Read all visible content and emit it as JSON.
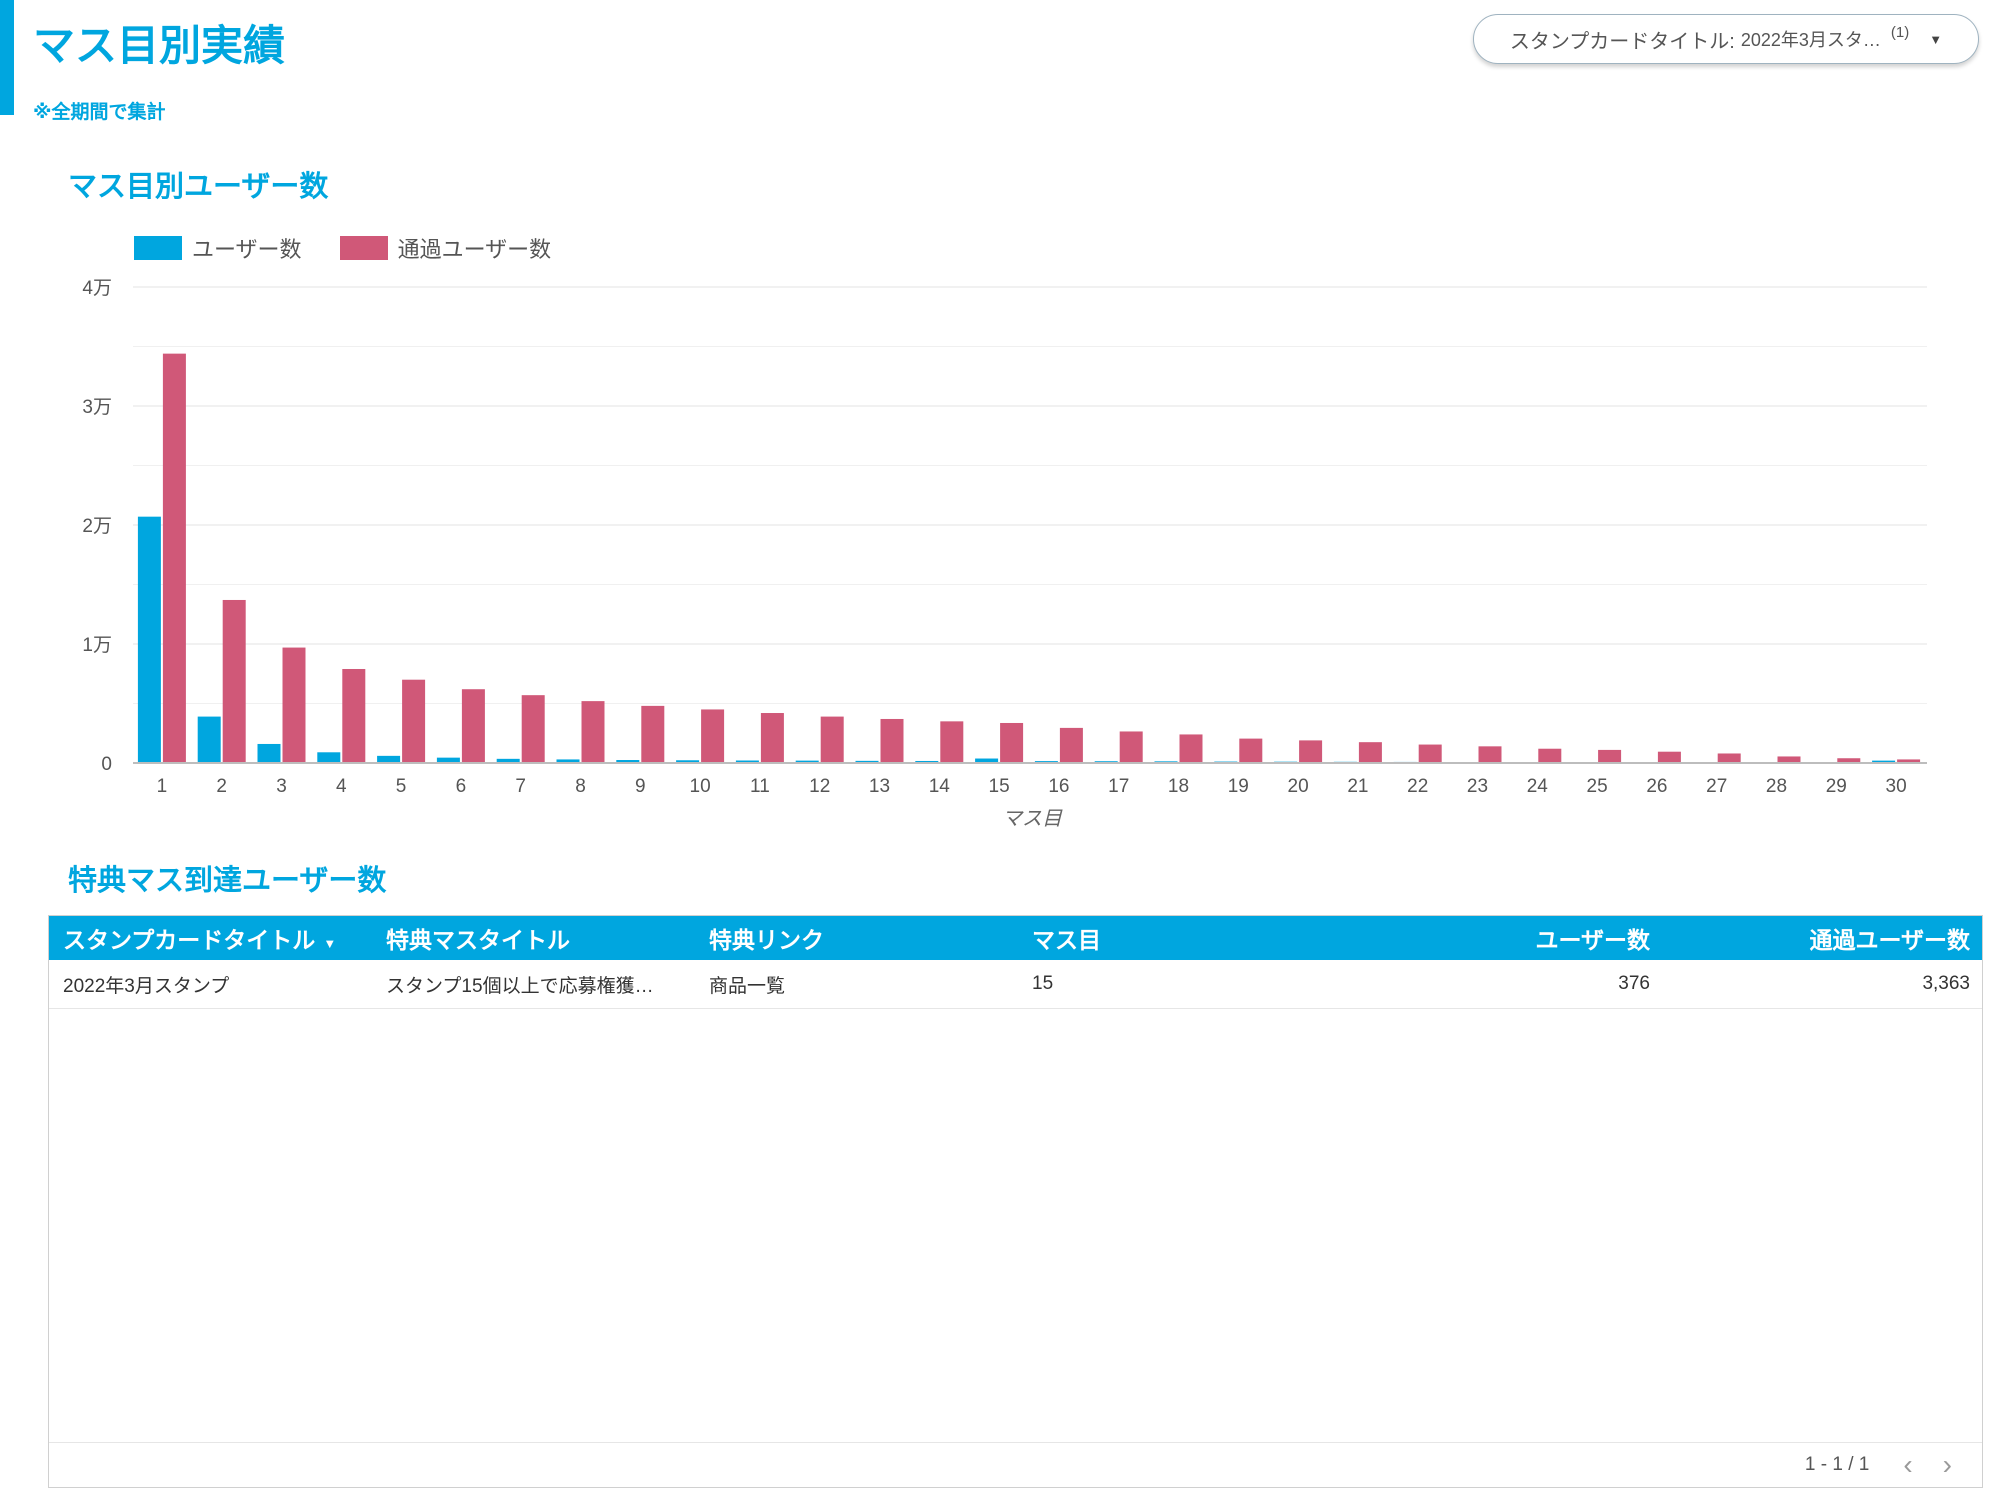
{
  "page": {
    "title": "マス目別実績",
    "note": "※全期間で集計"
  },
  "filter": {
    "label": "スタンプカードタイトル:",
    "value": "2022年3月スタ…",
    "count": "(1)"
  },
  "chart_section": {
    "title": "マス目別ユーザー数"
  },
  "chart_data": {
    "type": "bar",
    "xlabel": "マス目",
    "ylabel": "",
    "ylim": [
      0,
      40000
    ],
    "yticks": [
      0,
      10000,
      20000,
      30000,
      40000
    ],
    "ytick_labels": [
      "0",
      "1万",
      "2万",
      "3万",
      "4万"
    ],
    "grid": true,
    "legend_position": "top-left",
    "categories": [
      "1",
      "2",
      "3",
      "4",
      "5",
      "6",
      "7",
      "8",
      "9",
      "10",
      "11",
      "12",
      "13",
      "14",
      "15",
      "16",
      "17",
      "18",
      "19",
      "20",
      "21",
      "22",
      "23",
      "24",
      "25",
      "26",
      "27",
      "28",
      "29",
      "30"
    ],
    "series": [
      {
        "name": "ユーザー数",
        "color": "#00a6df",
        "values": [
          20700,
          3900,
          1600,
          900,
          600,
          450,
          350,
          300,
          250,
          230,
          210,
          200,
          180,
          170,
          376,
          160,
          150,
          140,
          120,
          110,
          100,
          90,
          80,
          70,
          60,
          50,
          40,
          30,
          30,
          200
        ]
      },
      {
        "name": "通過ユーザー数",
        "color": "#d05878",
        "values": [
          34400,
          13700,
          9700,
          7900,
          7000,
          6200,
          5700,
          5200,
          4800,
          4500,
          4200,
          3900,
          3700,
          3500,
          3363,
          2950,
          2650,
          2400,
          2050,
          1900,
          1750,
          1550,
          1400,
          1200,
          1100,
          950,
          800,
          550,
          400,
          300
        ]
      }
    ]
  },
  "table_section": {
    "title": "特典マス到達ユーザー数"
  },
  "table": {
    "columns": [
      "スタンプカードタイトル",
      "特典マスタイトル",
      "特典リンク",
      "マス目",
      "ユーザー数",
      "通過ユーザー数"
    ],
    "rows": [
      [
        "2022年3月スタンプ",
        "スタンプ15個以上で応募権獲…",
        "商品一覧",
        "15",
        "376",
        "3,363"
      ]
    ],
    "pagination": "1 - 1 / 1"
  },
  "icons": {
    "filter_caret": "caret-down-icon",
    "sort": "sort-desc-icon",
    "prev": "chevron-left-icon",
    "next": "chevron-right-icon"
  },
  "colors": {
    "accent": "#00a6df",
    "series_users": "#00a6df",
    "series_passed": "#d05878"
  }
}
